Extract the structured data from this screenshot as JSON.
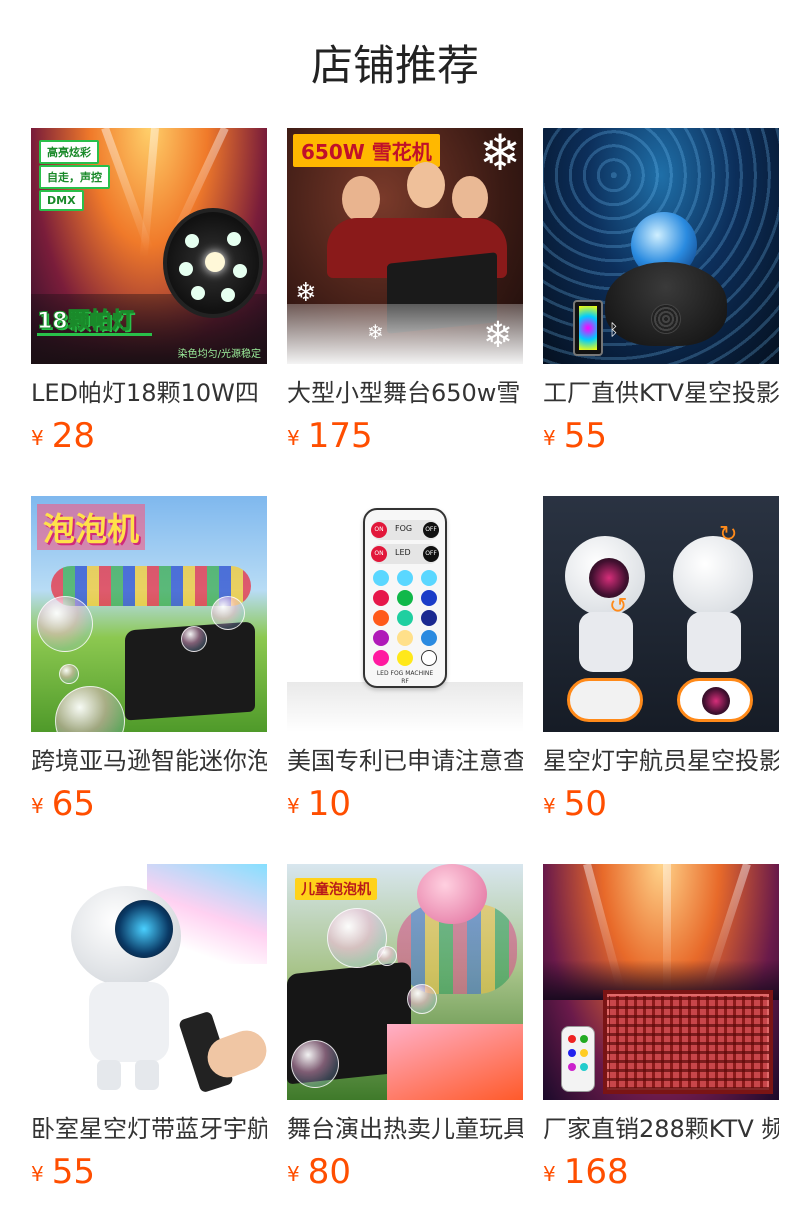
{
  "section": {
    "title": "店铺推荐"
  },
  "currency_symbol": "¥",
  "colors": {
    "price": "#ff4e00",
    "title": "#333333"
  },
  "products": [
    {
      "title": "LED帕灯18颗10W四",
      "price": "28",
      "image_text": {
        "badge1": "高亮炫彩",
        "badge2": "自走，声控",
        "badge3": "DMX",
        "big": "18颗帕灯",
        "corner": "染色均匀/光源稳定"
      }
    },
    {
      "title": "大型小型舞台650w雪",
      "price": "175",
      "image_text": {
        "banner": "650W 雪花机"
      }
    },
    {
      "title": "工厂直供KTV星空投影",
      "price": "55",
      "image_text": {}
    },
    {
      "title": "跨境亚马逊智能迷你泡",
      "price": "65",
      "image_text": {
        "banner": "泡泡机"
      }
    },
    {
      "title": "美国专利已申请注意查",
      "price": "10",
      "image_text": {
        "on1": "ON",
        "fog": "FOG",
        "off1": "OFF",
        "on2": "ON",
        "led": "LED",
        "off2": "OFF",
        "machine": "LED FOG MACHINE",
        "rf": "RF"
      }
    },
    {
      "title": "星空灯宇航员星空投影",
      "price": "50",
      "image_text": {}
    },
    {
      "title": "卧室星空灯带蓝牙宇航",
      "price": "55",
      "image_text": {}
    },
    {
      "title": "舞台演出热卖儿童玩具",
      "price": "80",
      "image_text": {
        "banner": "儿童泡泡机"
      }
    },
    {
      "title": "厂家直销288颗KTV 频",
      "price": "168",
      "image_text": {}
    }
  ]
}
